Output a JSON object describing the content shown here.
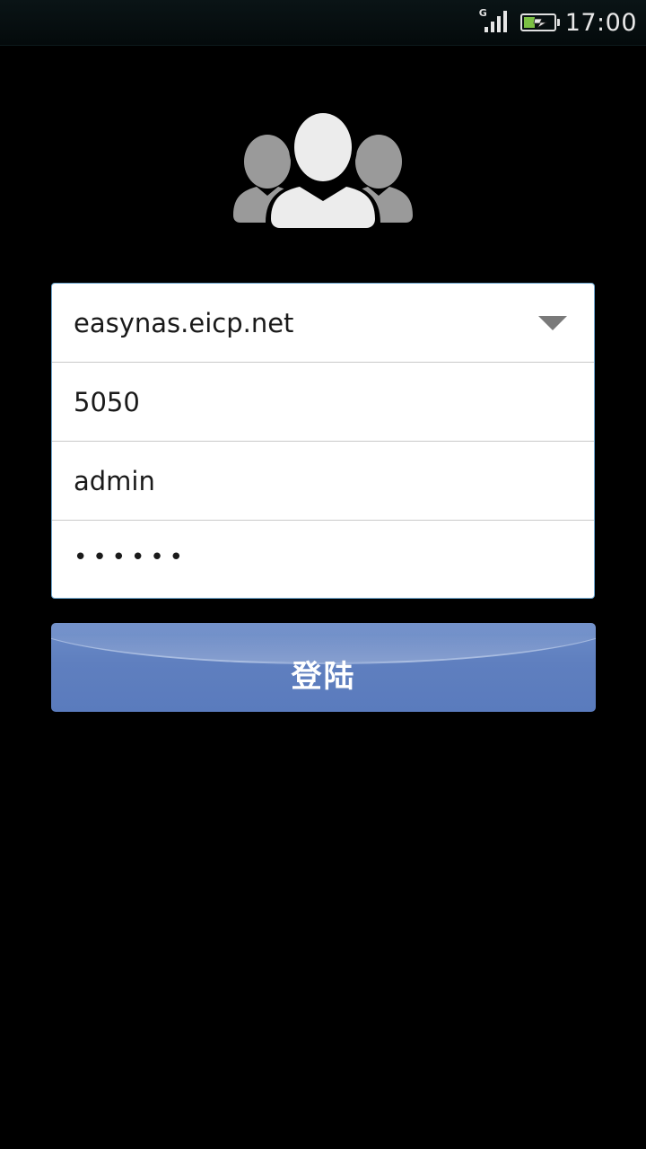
{
  "status_bar": {
    "network_type": "G",
    "signal_icon": "signal-bars-icon",
    "battery_icon": "battery-charging-icon",
    "time": "17:00"
  },
  "header": {
    "icon": "users-group-icon"
  },
  "login_form": {
    "server": {
      "value": "easynas.eicp.net",
      "icon": "dropdown-arrow-icon"
    },
    "port": {
      "value": "5050"
    },
    "username": {
      "value": "admin"
    },
    "password": {
      "masked_value": "••••••"
    }
  },
  "login_button": {
    "label": "登陆"
  },
  "colors": {
    "background": "#000000",
    "form_border": "#6fa7cf",
    "button": "#5f7fbf",
    "battery_fill": "#7bc043"
  }
}
